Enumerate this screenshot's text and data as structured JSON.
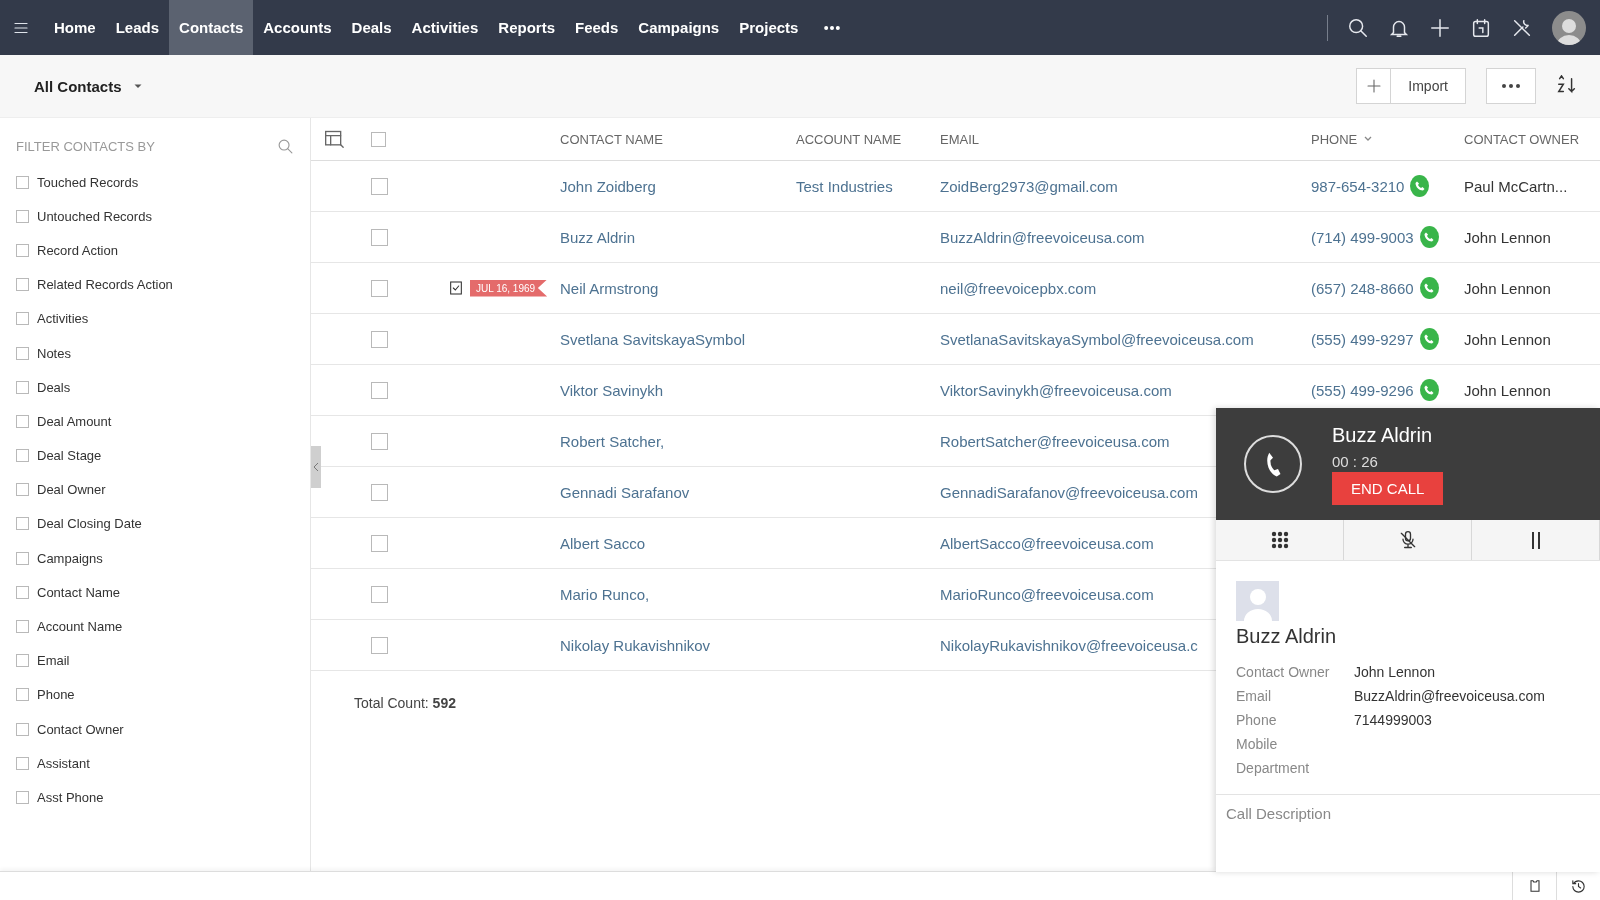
{
  "nav": {
    "items": [
      {
        "label": "Home",
        "selected": false
      },
      {
        "label": "Leads",
        "selected": false
      },
      {
        "label": "Contacts",
        "selected": true
      },
      {
        "label": "Accounts",
        "selected": false
      },
      {
        "label": "Deals",
        "selected": false
      },
      {
        "label": "Activities",
        "selected": false
      },
      {
        "label": "Reports",
        "selected": false
      },
      {
        "label": "Feeds",
        "selected": false
      },
      {
        "label": "Campaigns",
        "selected": false
      },
      {
        "label": "Projects",
        "selected": false
      }
    ]
  },
  "toolbar": {
    "view": "All Contacts",
    "import": "Import"
  },
  "filters": {
    "title": "FILTER CONTACTS BY",
    "items": [
      {
        "label": "Touched Records",
        "checked": false
      },
      {
        "label": "Untouched Records",
        "checked": false
      },
      {
        "label": "Record Action",
        "checked": false
      },
      {
        "label": "Related Records Action",
        "checked": false
      },
      {
        "label": "Activities",
        "checked": false
      },
      {
        "label": "Notes",
        "checked": false
      },
      {
        "label": "Deals",
        "checked": false
      },
      {
        "label": "Deal Amount",
        "checked": false
      },
      {
        "label": "Deal Stage",
        "checked": false
      },
      {
        "label": "Deal Owner",
        "checked": false
      },
      {
        "label": "Deal Closing Date",
        "checked": false
      },
      {
        "label": "Campaigns",
        "checked": false
      },
      {
        "label": "Contact Name",
        "checked": false
      },
      {
        "label": "Account Name",
        "checked": false
      },
      {
        "label": "Email",
        "checked": false
      },
      {
        "label": "Phone",
        "checked": false
      },
      {
        "label": "Contact Owner",
        "checked": false
      },
      {
        "label": "Assistant",
        "checked": false
      },
      {
        "label": "Asst Phone",
        "checked": false
      }
    ]
  },
  "table": {
    "columns": [
      {
        "label": "CONTACT NAME",
        "sorted": false
      },
      {
        "label": "ACCOUNT NAME",
        "sorted": false
      },
      {
        "label": "EMAIL",
        "sorted": false
      },
      {
        "label": "PHONE",
        "sorted": true
      },
      {
        "label": "CONTACT OWNER",
        "sorted": false
      }
    ],
    "all_checked": false,
    "rows": [
      {
        "checked": false,
        "name": "John Zoidberg",
        "account": "Test Industries",
        "email": "ZoidBerg2973@gmail.com",
        "phone": "987-654-3210",
        "owner": "Paul McCartn..."
      },
      {
        "checked": false,
        "name": "Buzz Aldrin",
        "email": "BuzzAldrin@freevoiceusa.com",
        "phone": "(714) 499-9003",
        "owner": "John Lennon"
      },
      {
        "checked": false,
        "name": "Neil Armstrong",
        "tag": "JUL 16, 1969",
        "email": "neil@freevoicepbx.com",
        "phone": "(657) 248-8660",
        "owner": "John Lennon"
      },
      {
        "checked": false,
        "name": "Svetlana SavitskayaSymbol",
        "email": "SvetlanaSavitskayaSymbol@freevoiceusa.com",
        "phone": "(555) 499-9297",
        "owner": "John Lennon"
      },
      {
        "checked": false,
        "name": "Viktor Savinykh",
        "email": "ViktorSavinykh@freevoiceusa.com",
        "phone": "(555) 499-9296",
        "owner": "John Lennon"
      },
      {
        "checked": false,
        "name": "Robert Satcher,",
        "email": "RobertSatcher@freevoiceusa.com"
      },
      {
        "checked": false,
        "name": "Gennadi Sarafanov",
        "email": "GennadiSarafanov@freevoiceusa.com"
      },
      {
        "checked": false,
        "name": "Albert Sacco",
        "email": "AlbertSacco@freevoiceusa.com"
      },
      {
        "checked": false,
        "name": "Mario Runco,",
        "email": "MarioRunco@freevoiceusa.com"
      },
      {
        "checked": false,
        "name": "Nikolay Rukavishnikov",
        "email": "NikolayRukavishnikov@freevoiceusa.c"
      }
    ],
    "total": "Total Count: **592**"
  },
  "call": {
    "name": "Buzz Aldrin",
    "timer": "00 : 26",
    "end_button": "END CALL",
    "contact": {
      "name": "Buzz Aldrin",
      "fields": [
        {
          "label": "Contact Owner",
          "value": "John Lennon"
        },
        {
          "label": "Email",
          "value": "BuzzAldrin@freevoiceusa.com"
        },
        {
          "label": "Phone",
          "value": "7144999003"
        },
        {
          "label": "Mobile"
        },
        {
          "label": "Department"
        }
      ]
    },
    "description_placeholder": "Call Description"
  }
}
